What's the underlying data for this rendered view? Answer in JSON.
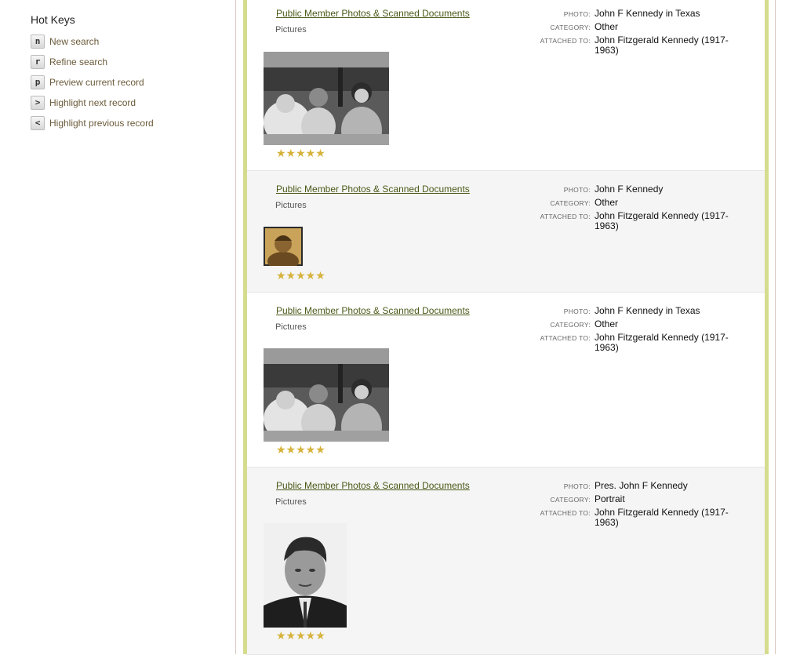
{
  "hotkeys": {
    "title": "Hot Keys",
    "items": [
      {
        "key": "n",
        "label": "New search"
      },
      {
        "key": "r",
        "label": "Refine search"
      },
      {
        "key": "p",
        "label": "Preview current record"
      },
      {
        "key": ">",
        "label": "Highlight next record"
      },
      {
        "key": "<",
        "label": "Highlight previous record"
      }
    ]
  },
  "labels": {
    "photo": "PHOTO:",
    "category": "CATEGORY:",
    "attached_to": "ATTACHED TO:"
  },
  "records": [
    {
      "collection": "Public Member Photos & Scanned Documents",
      "type": "Pictures",
      "photo": "John F Kennedy in Texas",
      "category": "Other",
      "attached_to": "John Fitzgerald Kennedy (1917-1963)",
      "stars": "★★★★★",
      "thumbnail": "motorcade-photo"
    },
    {
      "collection": "Public Member Photos & Scanned Documents",
      "type": "Pictures",
      "photo": "John F Kennedy",
      "category": "Other",
      "attached_to": "John Fitzgerald Kennedy (1917-1963)",
      "stars": "★★★★★",
      "thumbnail": "sepia-portrait"
    },
    {
      "collection": "Public Member Photos & Scanned Documents",
      "type": "Pictures",
      "photo": "John F Kennedy in Texas",
      "category": "Other",
      "attached_to": "John Fitzgerald Kennedy (1917-1963)",
      "stars": "★★★★★",
      "thumbnail": "motorcade-photo"
    },
    {
      "collection": "Public Member Photos & Scanned Documents",
      "type": "Pictures",
      "photo": "Pres. John F Kennedy",
      "category": "Portrait",
      "attached_to": "John Fitzgerald Kennedy (1917-1963)",
      "stars": "★★★★★",
      "thumbnail": "bw-portrait"
    }
  ],
  "colors": {
    "link": "#4a5a18",
    "star": "#d6b23a",
    "frame_green": "#d6dc8e",
    "alt_row": "#f5f5f5"
  }
}
